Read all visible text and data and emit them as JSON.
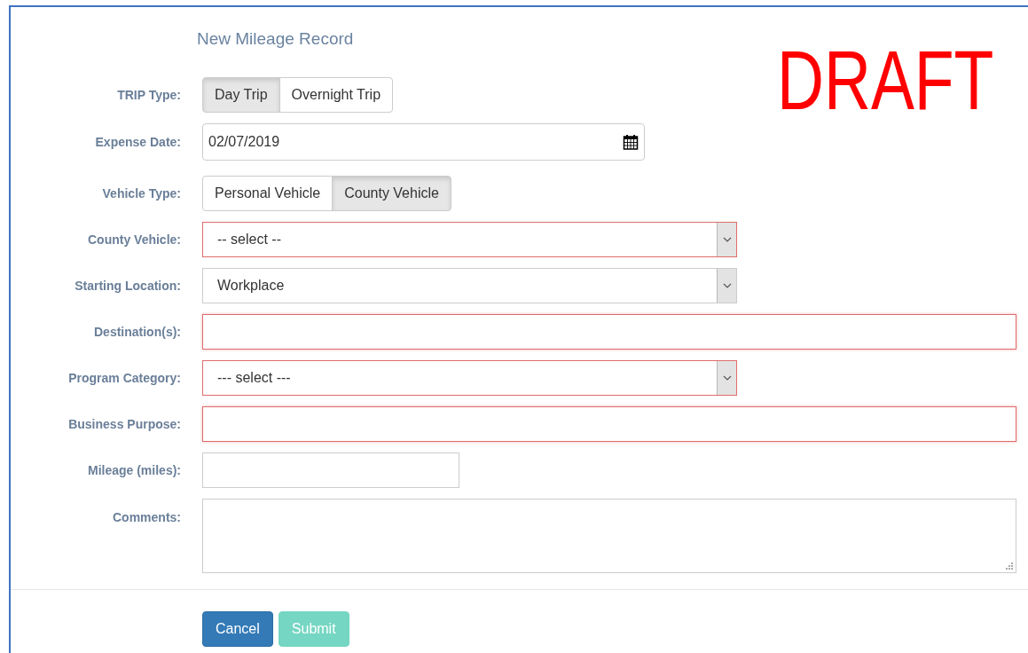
{
  "title": "New Mileage Record",
  "stamp": "DRAFT",
  "fields": [
    {
      "kind": "toggle",
      "label": "TRIP Type:",
      "options": [
        {
          "label": "Day Trip",
          "selected": true
        },
        {
          "label": "Overnight Trip",
          "selected": false
        }
      ]
    },
    {
      "kind": "date",
      "label": "Expense Date:",
      "value": "02/07/2019"
    },
    {
      "kind": "toggle",
      "label": "Vehicle Type:",
      "options": [
        {
          "label": "Personal Vehicle",
          "selected": false
        },
        {
          "label": "County Vehicle",
          "selected": true
        }
      ]
    },
    {
      "kind": "select",
      "label": "County Vehicle:",
      "value": "-- select --",
      "invalid": true
    },
    {
      "kind": "select",
      "label": "Starting Location:",
      "value": "Workplace",
      "invalid": false
    },
    {
      "kind": "text",
      "label": "Destination(s):",
      "invalid": true
    },
    {
      "kind": "select",
      "label": "Program Category:",
      "value": "--- select ---",
      "invalid": true
    },
    {
      "kind": "text",
      "label": "Business Purpose:",
      "invalid": true
    },
    {
      "kind": "number",
      "label": "Mileage (miles):",
      "invalid": false
    },
    {
      "kind": "textarea",
      "label": "Comments:"
    }
  ],
  "buttons": [
    {
      "label": "Cancel",
      "kind": "primary",
      "disabled": false
    },
    {
      "label": "Submit",
      "kind": "success",
      "disabled": true
    }
  ]
}
